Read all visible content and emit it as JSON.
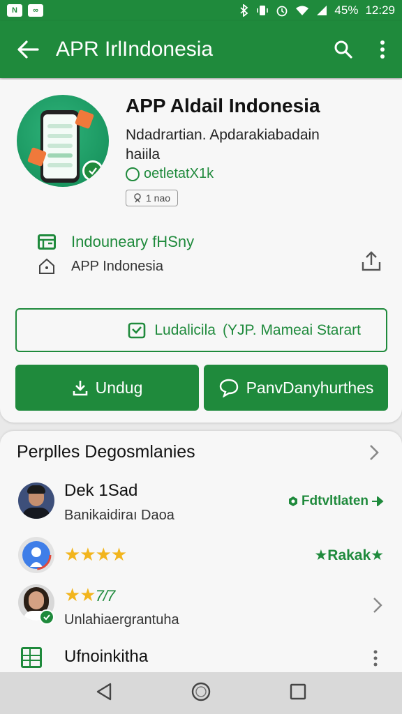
{
  "status": {
    "battery": "45%",
    "time": "12:29",
    "notif_icons": [
      "N",
      "∞"
    ]
  },
  "appbar": {
    "title": "APR IrlIndonesia",
    "back_icon": "arrow-left-icon",
    "search_icon": "search-icon",
    "menu_icon": "more-vert-icon"
  },
  "app": {
    "name": "APP Aldail Indonesia",
    "developer": "Ndadrartian. Apdarakiabadain haiila",
    "tag": "oetletatX1k",
    "rating_chip": "1 nao",
    "info1": "Indouneary fHSny",
    "info2": "APP Indonesia"
  },
  "buttons": {
    "outline": "Ludalicila  (YJP. Mameai Starart",
    "download": "Undug",
    "share": "PanvDanyhurthes"
  },
  "section": {
    "title": "Perplles Degosmlanies",
    "rows": [
      {
        "name": "Dek 1Sad",
        "sub": "Banikaidiraı Daoa",
        "right": "Fdtvltlaten"
      },
      {
        "stars": "★★★★",
        "right": "★Rakak★"
      },
      {
        "stars": "★★",
        "stars_extra": "7/7",
        "sub": "Unlahiaergrantuha"
      },
      {
        "name": "Ufnoinkitha"
      }
    ]
  },
  "colors": {
    "primary": "#1f8a3c",
    "star": "#f2b51d",
    "background": "#f7f7f7"
  }
}
